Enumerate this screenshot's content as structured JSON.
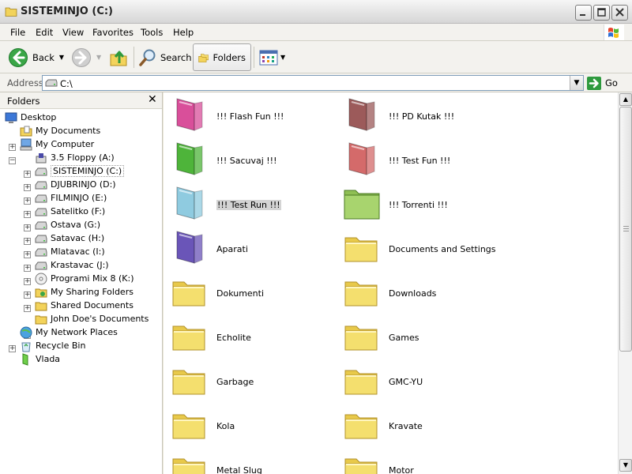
{
  "window": {
    "title": "SISTEMINJO (C:)"
  },
  "menu": {
    "items": [
      "File",
      "Edit",
      "View",
      "Favorites",
      "Tools",
      "Help"
    ]
  },
  "toolbar": {
    "back_label": "Back",
    "search_label": "Search",
    "folders_label": "Folders"
  },
  "address": {
    "label": "Address",
    "value": "C:\\",
    "go_label": "Go"
  },
  "folders_pane": {
    "title": "Folders",
    "tree": [
      {
        "label": "Desktop",
        "icon": "desktop-icon"
      },
      {
        "label": "My Documents",
        "icon": "my-documents-icon"
      },
      {
        "label": "My Computer",
        "icon": "my-computer-icon"
      },
      {
        "label": "3.5 Floppy (A:)",
        "icon": "floppy-icon"
      },
      {
        "label": "SISTEMINJO (C:)",
        "icon": "drive-icon"
      },
      {
        "label": "DJUBRINJO (D:)",
        "icon": "drive-icon"
      },
      {
        "label": "FILMINJO (E:)",
        "icon": "drive-icon"
      },
      {
        "label": "Satelitko (F:)",
        "icon": "drive-icon"
      },
      {
        "label": "Ostava (G:)",
        "icon": "drive-icon"
      },
      {
        "label": "Satavac (H:)",
        "icon": "drive-icon"
      },
      {
        "label": "Mlatavac (I:)",
        "icon": "drive-icon"
      },
      {
        "label": "Krastavac (J:)",
        "icon": "drive-icon"
      },
      {
        "label": "Programi Mix 8 (K:)",
        "icon": "cd-drive-icon"
      },
      {
        "label": "My Sharing Folders",
        "icon": "sharing-folder-icon"
      },
      {
        "label": "Shared Documents",
        "icon": "folder-icon"
      },
      {
        "label": "John Doe's Documents",
        "icon": "folder-icon"
      },
      {
        "label": "My Network Places",
        "icon": "network-icon"
      },
      {
        "label": "Recycle Bin",
        "icon": "recycle-bin-icon"
      },
      {
        "label": "Vlada",
        "icon": "green-folder-icon"
      }
    ]
  },
  "content": {
    "items": [
      {
        "name": "!!! Flash Fun !!!",
        "color": "#d94f9a"
      },
      {
        "name": "!!! PD Kutak !!!",
        "color": "#9c5a5a"
      },
      {
        "name": "!!! Sacuvaj !!!",
        "color": "#4eb43a"
      },
      {
        "name": "!!! Test Fun !!!",
        "color": "#d46a6a"
      },
      {
        "name": "!!! Test Run !!!",
        "color": "#8fcbe0"
      },
      {
        "name": "!!! Torrenti !!!",
        "color": "#a8d46e"
      },
      {
        "name": "Aparati",
        "color": "#6a55b8"
      },
      {
        "name": "Documents and Settings",
        "color": "#f4df6e"
      },
      {
        "name": "Dokumenti",
        "color": "#f4df6e"
      },
      {
        "name": "Downloads",
        "color": "#f4df6e"
      },
      {
        "name": "Echolite",
        "color": "#f4df6e"
      },
      {
        "name": "Games",
        "color": "#f4df6e"
      },
      {
        "name": "Garbage",
        "color": "#f4df6e"
      },
      {
        "name": "GMC-YU",
        "color": "#f4df6e"
      },
      {
        "name": "Kola",
        "color": "#f4df6e"
      },
      {
        "name": "Kravate",
        "color": "#f4df6e"
      },
      {
        "name": "Metal Slug",
        "color": "#f4df6e"
      },
      {
        "name": "Motor",
        "color": "#f4df6e"
      }
    ]
  }
}
